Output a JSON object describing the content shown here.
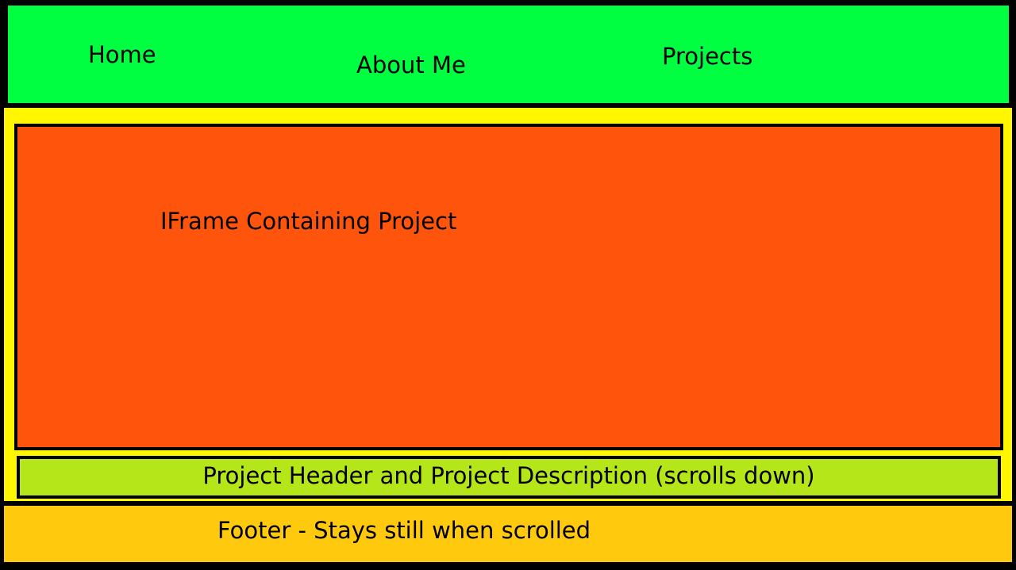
{
  "nav": {
    "items": [
      {
        "label": "Home"
      },
      {
        "label": "About Me"
      },
      {
        "label": "Projects"
      }
    ]
  },
  "main": {
    "iframe_label": "IFrame Containing Project",
    "description_label": "Project Header and Project Description (scrolls down)"
  },
  "footer": {
    "label": "Footer - Stays still when scrolled"
  },
  "colors": {
    "background": "#000000",
    "nav": "#00ff41",
    "content": "#fff600",
    "iframe": "#ff540c",
    "description": "#b4e61a",
    "footer": "#ffc90e"
  }
}
